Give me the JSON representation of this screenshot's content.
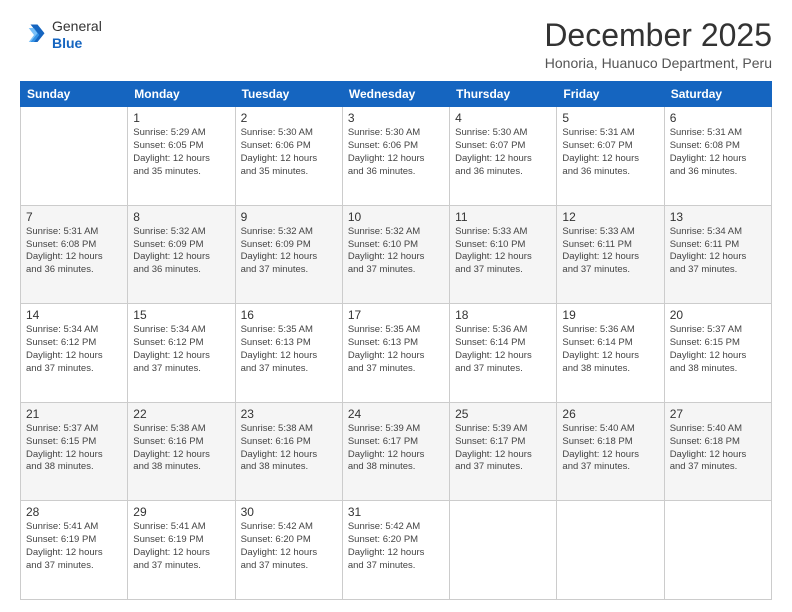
{
  "header": {
    "logo": {
      "line1": "General",
      "line2": "Blue"
    },
    "title": "December 2025",
    "subtitle": "Honoria, Huanuco Department, Peru"
  },
  "calendar": {
    "days_of_week": [
      "Sunday",
      "Monday",
      "Tuesday",
      "Wednesday",
      "Thursday",
      "Friday",
      "Saturday"
    ],
    "weeks": [
      [
        {
          "num": "",
          "info": ""
        },
        {
          "num": "1",
          "info": "Sunrise: 5:29 AM\nSunset: 6:05 PM\nDaylight: 12 hours\nand 35 minutes."
        },
        {
          "num": "2",
          "info": "Sunrise: 5:30 AM\nSunset: 6:06 PM\nDaylight: 12 hours\nand 35 minutes."
        },
        {
          "num": "3",
          "info": "Sunrise: 5:30 AM\nSunset: 6:06 PM\nDaylight: 12 hours\nand 36 minutes."
        },
        {
          "num": "4",
          "info": "Sunrise: 5:30 AM\nSunset: 6:07 PM\nDaylight: 12 hours\nand 36 minutes."
        },
        {
          "num": "5",
          "info": "Sunrise: 5:31 AM\nSunset: 6:07 PM\nDaylight: 12 hours\nand 36 minutes."
        },
        {
          "num": "6",
          "info": "Sunrise: 5:31 AM\nSunset: 6:08 PM\nDaylight: 12 hours\nand 36 minutes."
        }
      ],
      [
        {
          "num": "7",
          "info": "Sunrise: 5:31 AM\nSunset: 6:08 PM\nDaylight: 12 hours\nand 36 minutes."
        },
        {
          "num": "8",
          "info": "Sunrise: 5:32 AM\nSunset: 6:09 PM\nDaylight: 12 hours\nand 36 minutes."
        },
        {
          "num": "9",
          "info": "Sunrise: 5:32 AM\nSunset: 6:09 PM\nDaylight: 12 hours\nand 37 minutes."
        },
        {
          "num": "10",
          "info": "Sunrise: 5:32 AM\nSunset: 6:10 PM\nDaylight: 12 hours\nand 37 minutes."
        },
        {
          "num": "11",
          "info": "Sunrise: 5:33 AM\nSunset: 6:10 PM\nDaylight: 12 hours\nand 37 minutes."
        },
        {
          "num": "12",
          "info": "Sunrise: 5:33 AM\nSunset: 6:11 PM\nDaylight: 12 hours\nand 37 minutes."
        },
        {
          "num": "13",
          "info": "Sunrise: 5:34 AM\nSunset: 6:11 PM\nDaylight: 12 hours\nand 37 minutes."
        }
      ],
      [
        {
          "num": "14",
          "info": "Sunrise: 5:34 AM\nSunset: 6:12 PM\nDaylight: 12 hours\nand 37 minutes."
        },
        {
          "num": "15",
          "info": "Sunrise: 5:34 AM\nSunset: 6:12 PM\nDaylight: 12 hours\nand 37 minutes."
        },
        {
          "num": "16",
          "info": "Sunrise: 5:35 AM\nSunset: 6:13 PM\nDaylight: 12 hours\nand 37 minutes."
        },
        {
          "num": "17",
          "info": "Sunrise: 5:35 AM\nSunset: 6:13 PM\nDaylight: 12 hours\nand 37 minutes."
        },
        {
          "num": "18",
          "info": "Sunrise: 5:36 AM\nSunset: 6:14 PM\nDaylight: 12 hours\nand 37 minutes."
        },
        {
          "num": "19",
          "info": "Sunrise: 5:36 AM\nSunset: 6:14 PM\nDaylight: 12 hours\nand 38 minutes."
        },
        {
          "num": "20",
          "info": "Sunrise: 5:37 AM\nSunset: 6:15 PM\nDaylight: 12 hours\nand 38 minutes."
        }
      ],
      [
        {
          "num": "21",
          "info": "Sunrise: 5:37 AM\nSunset: 6:15 PM\nDaylight: 12 hours\nand 38 minutes."
        },
        {
          "num": "22",
          "info": "Sunrise: 5:38 AM\nSunset: 6:16 PM\nDaylight: 12 hours\nand 38 minutes."
        },
        {
          "num": "23",
          "info": "Sunrise: 5:38 AM\nSunset: 6:16 PM\nDaylight: 12 hours\nand 38 minutes."
        },
        {
          "num": "24",
          "info": "Sunrise: 5:39 AM\nSunset: 6:17 PM\nDaylight: 12 hours\nand 38 minutes."
        },
        {
          "num": "25",
          "info": "Sunrise: 5:39 AM\nSunset: 6:17 PM\nDaylight: 12 hours\nand 37 minutes."
        },
        {
          "num": "26",
          "info": "Sunrise: 5:40 AM\nSunset: 6:18 PM\nDaylight: 12 hours\nand 37 minutes."
        },
        {
          "num": "27",
          "info": "Sunrise: 5:40 AM\nSunset: 6:18 PM\nDaylight: 12 hours\nand 37 minutes."
        }
      ],
      [
        {
          "num": "28",
          "info": "Sunrise: 5:41 AM\nSunset: 6:19 PM\nDaylight: 12 hours\nand 37 minutes."
        },
        {
          "num": "29",
          "info": "Sunrise: 5:41 AM\nSunset: 6:19 PM\nDaylight: 12 hours\nand 37 minutes."
        },
        {
          "num": "30",
          "info": "Sunrise: 5:42 AM\nSunset: 6:20 PM\nDaylight: 12 hours\nand 37 minutes."
        },
        {
          "num": "31",
          "info": "Sunrise: 5:42 AM\nSunset: 6:20 PM\nDaylight: 12 hours\nand 37 minutes."
        },
        {
          "num": "",
          "info": ""
        },
        {
          "num": "",
          "info": ""
        },
        {
          "num": "",
          "info": ""
        }
      ]
    ]
  }
}
